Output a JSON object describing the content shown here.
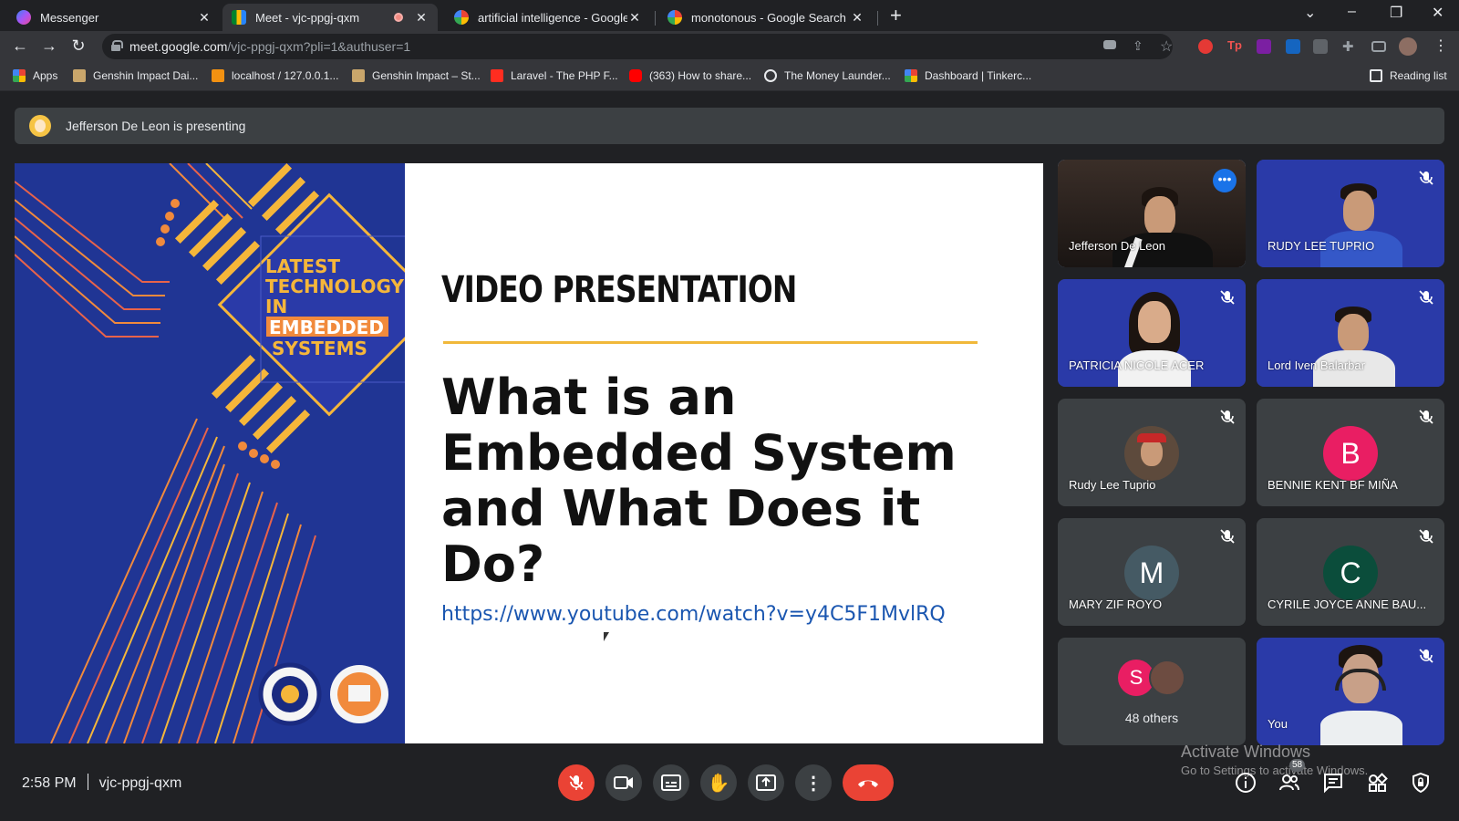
{
  "browser": {
    "tabs": [
      {
        "title": "Messenger",
        "favicon": "messenger-icon",
        "active": false
      },
      {
        "title": "Meet - vjc-ppgj-qxm",
        "favicon": "google-meet-icon",
        "active": true,
        "recording": true
      },
      {
        "title": "artificial intelligence - Google Sea",
        "favicon": "google-icon",
        "active": false
      },
      {
        "title": "monotonous - Google Search",
        "favicon": "google-icon",
        "active": false
      }
    ],
    "url_host": "meet.google.com",
    "url_path": "/vjc-ppgj-qxm?pli=1&authuser=1",
    "bookmarks": [
      {
        "label": "Apps",
        "icon": "apps-grid-icon"
      },
      {
        "label": "Genshin Impact Dai...",
        "icon": "genshin-favicon"
      },
      {
        "label": "localhost / 127.0.0.1...",
        "icon": "phpmyadmin-favicon"
      },
      {
        "label": "Genshin Impact – St...",
        "icon": "genshin-favicon"
      },
      {
        "label": "Laravel - The PHP F...",
        "icon": "laravel-favicon"
      },
      {
        "label": "(363) How to share...",
        "icon": "youtube-favicon"
      },
      {
        "label": "The Money Launder...",
        "icon": "infinity-favicon"
      },
      {
        "label": "Dashboard | Tinkerc...",
        "icon": "tinkercad-favicon"
      }
    ],
    "reading_list": "Reading list"
  },
  "meet": {
    "presenter_banner": "Jefferson De Leon is presenting",
    "slide": {
      "logo_lines": [
        "LATEST",
        "TECHNOLOGY",
        "IN",
        "EMBEDDED",
        "SYSTEMS"
      ],
      "heading": "VIDEO PRESENTATION",
      "question": "What is an Embedded System and What Does it Do?",
      "link": "https://www.youtube.com/watch?v=y4C5F1MvlRQ"
    },
    "participants": [
      {
        "name": "Jefferson De Leon",
        "type": "video",
        "speaking": true
      },
      {
        "name": "RUDY LEE TUPRIO",
        "type": "video",
        "muted": true
      },
      {
        "name": "PATRICIA NICOLE ACER",
        "type": "video",
        "muted": true
      },
      {
        "name": "Lord Iven Balarbar",
        "type": "video",
        "muted": true
      },
      {
        "name": "Rudy Lee Tuprio",
        "type": "photo",
        "muted": true
      },
      {
        "name": "BENNIE KENT BF MIÑA",
        "type": "letter",
        "letter": "B",
        "color": "#e91e63",
        "muted": true
      },
      {
        "name": "MARY ZIF ROYO",
        "type": "letter",
        "letter": "M",
        "color": "#455a64",
        "muted": true
      },
      {
        "name": "CYRILE JOYCE ANNE BAU...",
        "type": "letter",
        "letter": "C",
        "color": "#0b4d3b",
        "muted": true
      },
      {
        "name": "You",
        "type": "video",
        "muted": true
      }
    ],
    "others": {
      "letter": "S",
      "color": "#e91e63",
      "label": "48 others"
    },
    "time": "2:58 PM",
    "meeting_code": "vjc-ppgj-qxm",
    "participant_count": "58",
    "activate_windows": {
      "line1": "Activate Windows",
      "line2": "Go to Settings to activate Windows."
    }
  }
}
